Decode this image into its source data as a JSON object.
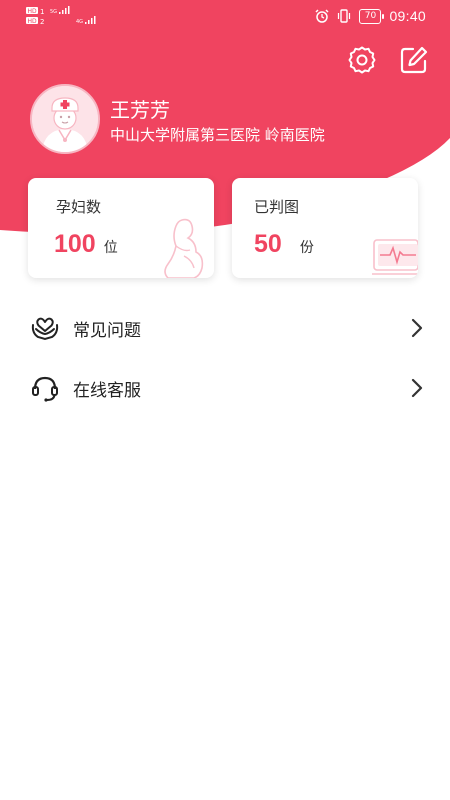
{
  "colors": {
    "accent": "#f04460",
    "background": "#ffffff",
    "text": "#222222"
  },
  "status_bar": {
    "time": "09:40",
    "battery": "70",
    "icons": [
      "hd-icon",
      "signal-icon",
      "alarm-icon",
      "vibrate-icon",
      "battery-icon"
    ]
  },
  "header": {
    "actions": [
      {
        "icon": "gear-icon"
      },
      {
        "icon": "edit-icon"
      }
    ]
  },
  "profile": {
    "name": "王芳芳",
    "hospital": "中山大学附属第三医院 岭南医院",
    "avatar_icon": "nurse-avatar-icon"
  },
  "stats": [
    {
      "title": "孕妇数",
      "value": "100",
      "unit": "位",
      "icon": "pregnant-woman-icon"
    },
    {
      "title": "已判图",
      "value": "50",
      "unit": "份",
      "icon": "monitor-icon"
    }
  ],
  "menu": [
    {
      "label": "常见问题",
      "icon": "heart-hands-icon"
    },
    {
      "label": "在线客服",
      "icon": "headset-icon"
    }
  ]
}
